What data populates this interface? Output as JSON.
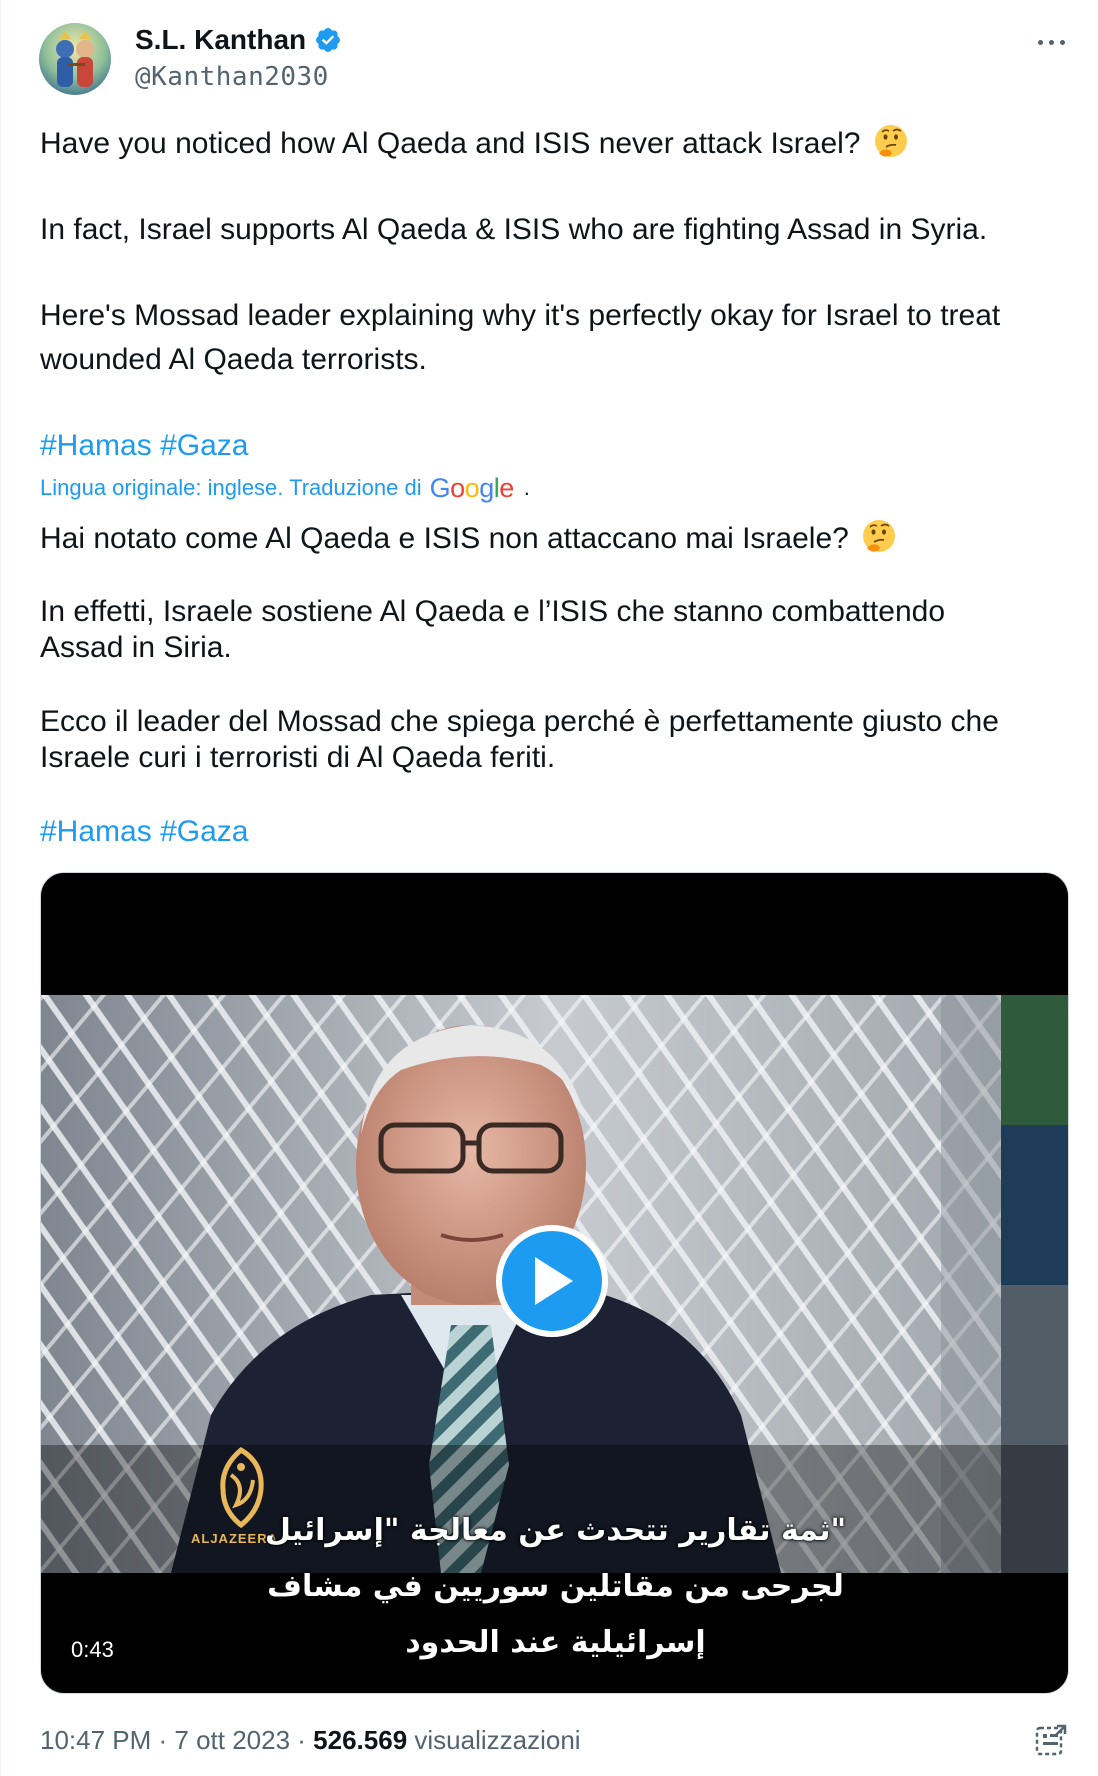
{
  "author": {
    "name": "S.L. Kanthan",
    "handle": "@Kanthan2030",
    "verified": true,
    "avatar_icon": "krishna-avatar-icon"
  },
  "tweet": {
    "line1": "Have you noticed how Al Qaeda and ISIS never attack Israel?",
    "line2": "In fact, Israel supports Al Qaeda & ISIS who are fighting Assad in Syria.",
    "line3a": "Here's Mossad leader explaining why it's perfectly okay for Israel to treat",
    "line3b": "wounded Al Qaeda terrorists.",
    "hashtag1": "#Hamas",
    "hashtag2": "#Gaza",
    "emoji": "thinking-face-icon"
  },
  "translation": {
    "note": "Lingua originale: inglese. Traduzione di",
    "provider": "Google",
    "dot": ".",
    "line1": "Hai notato come Al Qaeda e ISIS non attaccano mai Israele?",
    "line2a": "In effetti, Israele sostiene Al Qaeda e l’ISIS che stanno combattendo",
    "line2b": "Assad in Siria.",
    "line3a": "Ecco il leader del Mossad che spiega perché è perfettamente giusto che",
    "line3b": "Israele curi i terroristi di Al Qaeda feriti.",
    "hashtag1": "#Hamas",
    "hashtag2": "#Gaza"
  },
  "video": {
    "duration": "0:43",
    "channel": "ALJAZEERA",
    "subtitle1": "\"ثمة تقارير تتحدث عن معالجة \"إسرائيل",
    "subtitle2": "لجرحى من مقاتلين سوريين في مشاف",
    "subtitle3": "إسرائيلية عند الحدود"
  },
  "meta": {
    "time": "10:47 PM",
    "separator": " · ",
    "date": "7 ott 2023",
    "views_count": "526.569",
    "views_label": "visualizzazioni"
  },
  "colors": {
    "accent": "#1d9bf0",
    "text": "#0f1419",
    "muted": "#536471"
  }
}
